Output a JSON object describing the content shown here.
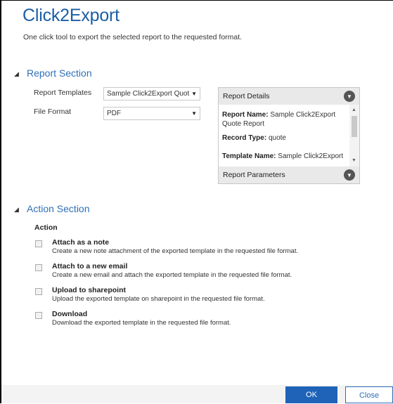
{
  "header": {
    "title": "Click2Export",
    "subtitle": "One click tool to export the selected report to the requested format."
  },
  "report_section": {
    "heading": "Report Section",
    "templates_label": "Report Templates",
    "templates_value": "Sample Click2Export Quot",
    "format_label": "File Format",
    "format_value": "PDF",
    "details_panel": {
      "header": "Report Details",
      "report_name_label": "Report Name:",
      "report_name_value": "Sample Click2Export Quote Report",
      "record_type_label": "Record Type:",
      "record_type_value": "quote",
      "template_name_label": "Template Name:",
      "template_name_value": "Sample Click2Export",
      "parameters_header": "Report Parameters"
    }
  },
  "action_section": {
    "heading": "Action Section",
    "column_label": "Action",
    "options": [
      {
        "title": "Attach as a note",
        "desc": "Create a new note attachment of the exported template in the requested file format."
      },
      {
        "title": "Attach to a new email",
        "desc": "Create a new email and attach the exported template in the requested file format."
      },
      {
        "title": "Upload to sharepoint",
        "desc": "Upload the exported template on sharepoint in the requested file format."
      },
      {
        "title": "Download",
        "desc": "Download the exported template in the requested file format."
      }
    ]
  },
  "footer": {
    "ok_label": "OK",
    "close_label": "Close"
  },
  "colors": {
    "accent": "#1b5ea6",
    "section_heading": "#2f6fb6",
    "ok_button": "#1e63b8"
  },
  "icons": {
    "collapse": "triangle-down-icon",
    "expand": "chevron-circle-down-icon"
  }
}
